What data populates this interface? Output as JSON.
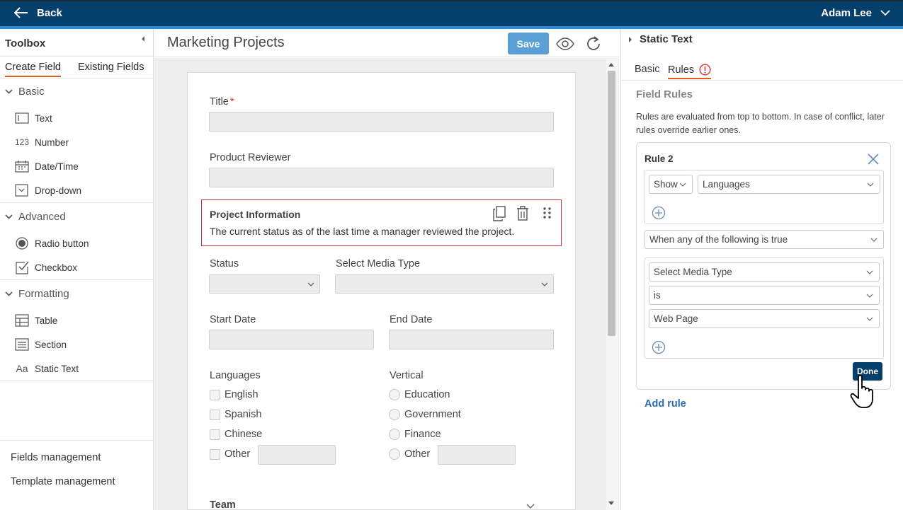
{
  "topbar": {
    "back_label": "Back",
    "user_name": "Adam Lee"
  },
  "toolbox": {
    "title": "Toolbox",
    "tabs": [
      {
        "label": "Create Field"
      },
      {
        "label": "Existing Fields"
      }
    ],
    "groups": [
      {
        "label": "Basic",
        "items": [
          {
            "label": "Text",
            "icon": "text-field-icon"
          },
          {
            "label": "Number",
            "icon": "number-icon",
            "glyph": "123"
          },
          {
            "label": "Date/Time",
            "icon": "calendar-icon"
          },
          {
            "label": "Drop-down",
            "icon": "dropdown-icon"
          }
        ]
      },
      {
        "label": "Advanced",
        "items": [
          {
            "label": "Radio button",
            "icon": "radio-icon"
          },
          {
            "label": "Checkbox",
            "icon": "checkbox-icon"
          }
        ]
      },
      {
        "label": "Formatting",
        "items": [
          {
            "label": "Table",
            "icon": "table-icon"
          },
          {
            "label": "Section",
            "icon": "section-icon"
          },
          {
            "label": "Static Text",
            "icon": "static-text-icon",
            "glyph": "Aa"
          }
        ]
      }
    ],
    "footer": [
      {
        "label": "Fields management"
      },
      {
        "label": "Template management"
      }
    ]
  },
  "editor": {
    "title": "Marketing Projects",
    "save_label": "Save",
    "fields": {
      "title": "Title",
      "required_mark": "*",
      "product_reviewer": "Product Reviewer",
      "section_title": "Project Information",
      "section_desc": "The current status as of the last time a manager reviewed the project.",
      "status": "Status",
      "media_type": "Select Media Type",
      "start_date": "Start Date",
      "end_date": "End Date",
      "languages": "Languages",
      "vertical": "Vertical",
      "team": "Team"
    },
    "language_options": [
      "English",
      "Spanish",
      "Chinese",
      "Other"
    ],
    "vertical_options": [
      "Education",
      "Government",
      "Finance",
      "Other"
    ]
  },
  "rules_panel": {
    "heading": "Static Text",
    "tabs": [
      {
        "label": "Basic"
      },
      {
        "label": "Rules"
      }
    ],
    "title": "Field Rules",
    "description": "Rules are evaluated from top to bottom. In case of conflict, later rules override earlier ones.",
    "rule": {
      "name": "Rule 2",
      "action": "Show",
      "target": "Languages",
      "condition_mode": "When any of the following is true",
      "condition_field": "Select Media Type",
      "operator": "is",
      "value": "Web Page",
      "done_label": "Done"
    },
    "add_rule_label": "Add rule"
  },
  "colors": {
    "topbar": "#053f6b",
    "accent": "#2c8ad6",
    "tab_underline": "#e05a1b",
    "section_border": "#c8333a",
    "link": "#2a6cb0"
  }
}
